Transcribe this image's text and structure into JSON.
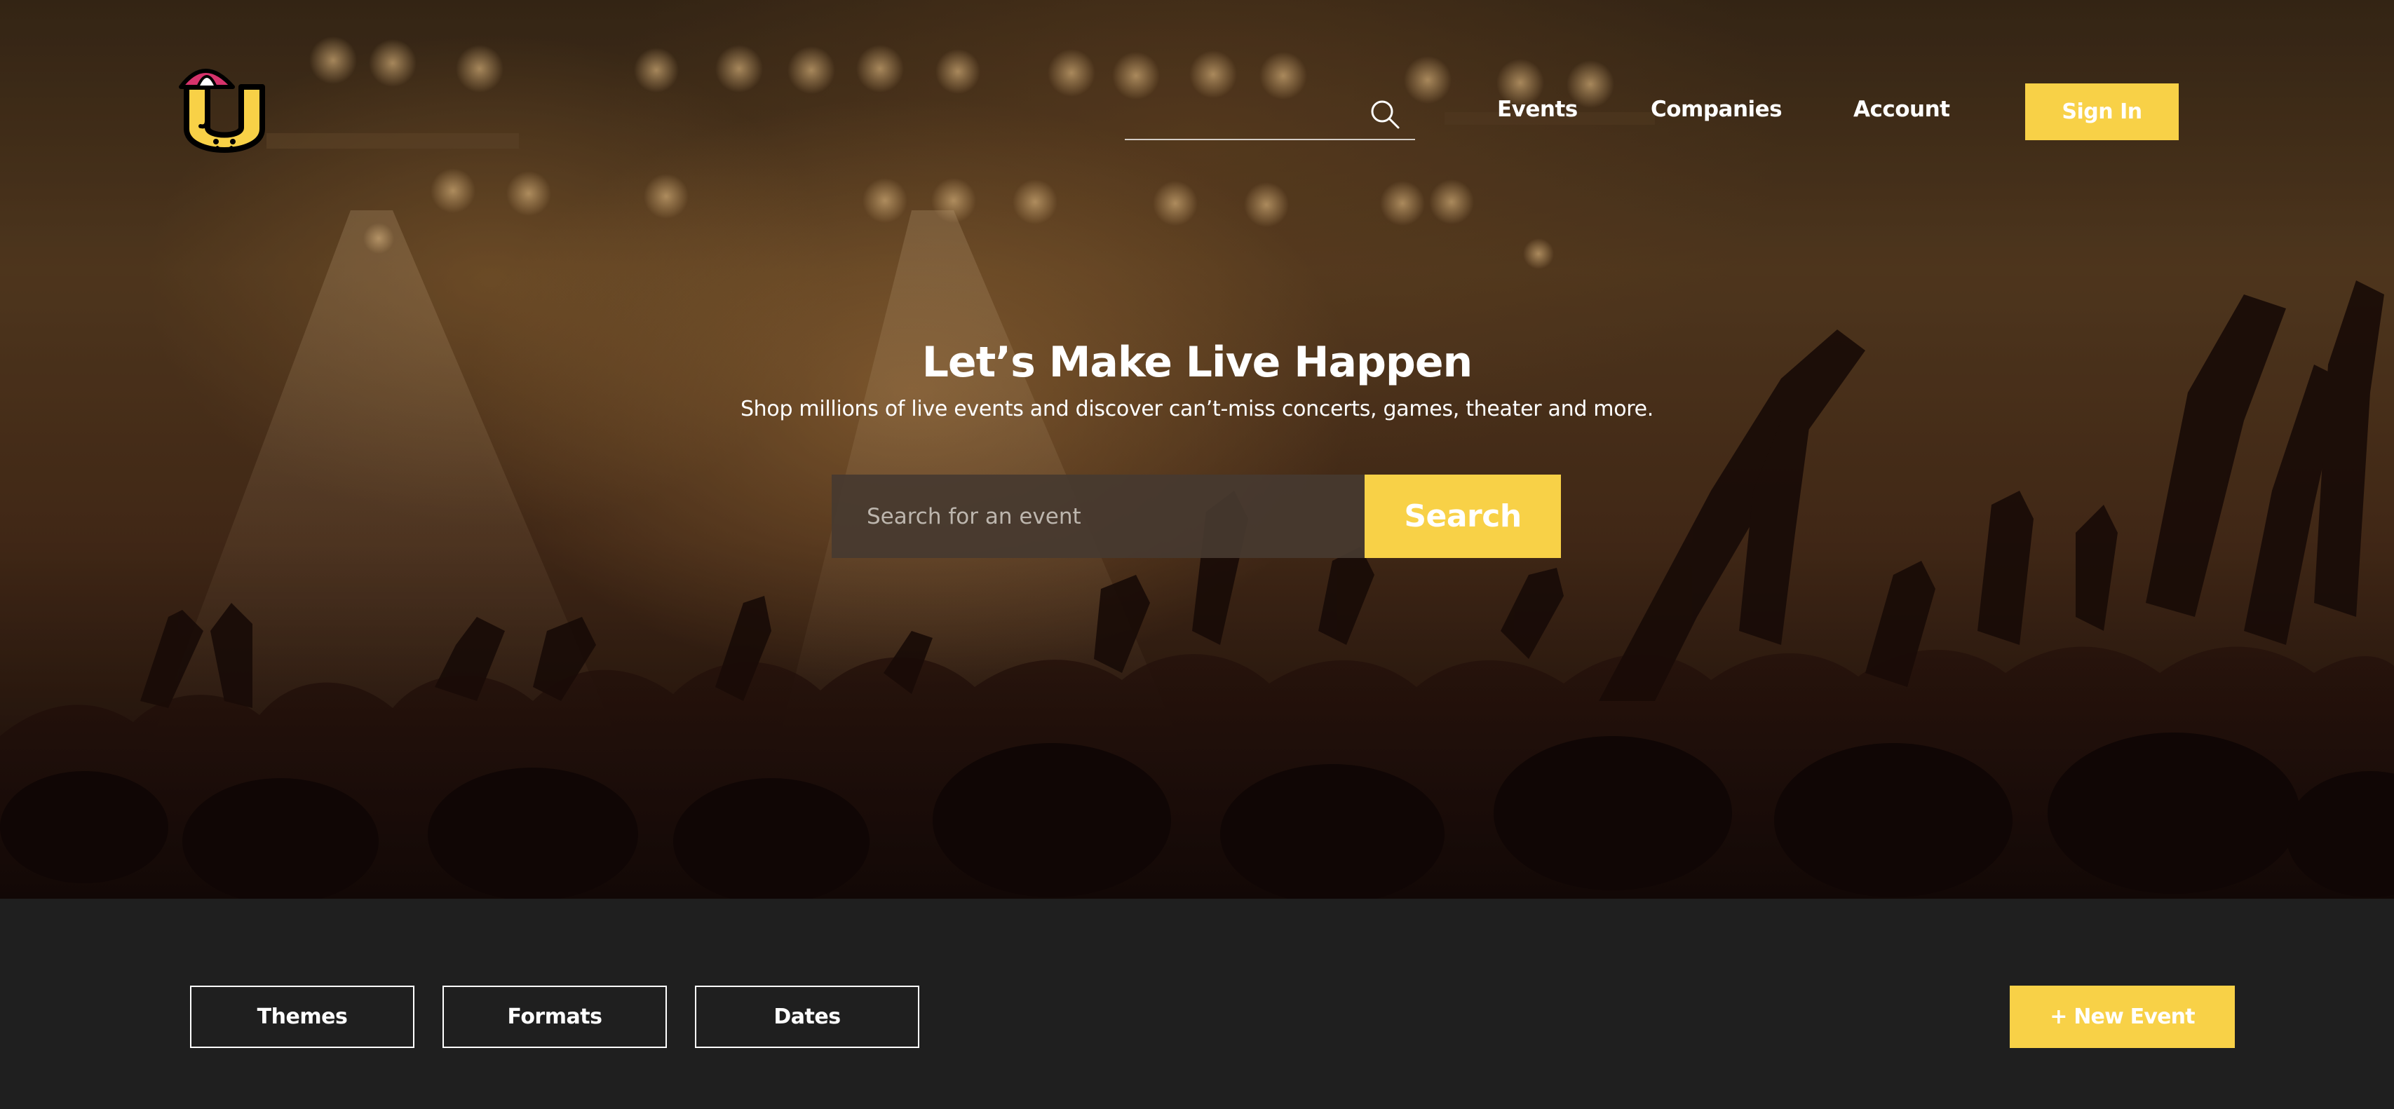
{
  "nav": {
    "search_placeholder": "",
    "links": [
      "Events",
      "Companies",
      "Account"
    ],
    "signin_label": "Sign In"
  },
  "hero": {
    "title": "Let’s Make Live Happen",
    "subtitle": "Shop millions of live events and discover can’t-miss concerts, games, theater and more.",
    "search_placeholder": "Search for an event",
    "search_button": "Search"
  },
  "filters": {
    "buttons": [
      "Themes",
      "Formats",
      "Dates"
    ],
    "new_event_label": "+ New Event"
  },
  "colors": {
    "accent": "#f8d147",
    "dark_bar": "#1f1f1f",
    "logo_umbrella": "#d6336c"
  },
  "icons": {
    "nav_search": "search-icon",
    "logo": "umbrella-u-logo"
  }
}
